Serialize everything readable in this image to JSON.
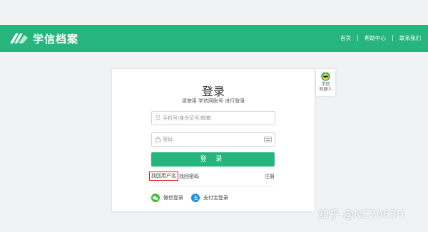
{
  "header": {
    "brand": "学信档案",
    "nav": [
      "首页",
      "帮助中心",
      "联系我们"
    ]
  },
  "login": {
    "title": "登录",
    "subtitle": "请使用 学信网账号 进行登录",
    "username_placeholder": "手机号/身份证号/邮箱",
    "password_placeholder": "密码",
    "login_button": "登 录",
    "find_username": "找回用户名",
    "find_password": "找回密码",
    "register": "注册",
    "wechat_login": "微信登录",
    "alipay_login": "支付宝登录"
  },
  "robot": {
    "label_line1": "学信",
    "label_line2": "机器人"
  },
  "watermark": "知乎 @NC2063H",
  "colors": {
    "brand_green": "#27b57e",
    "highlight_red": "#d8262c"
  }
}
